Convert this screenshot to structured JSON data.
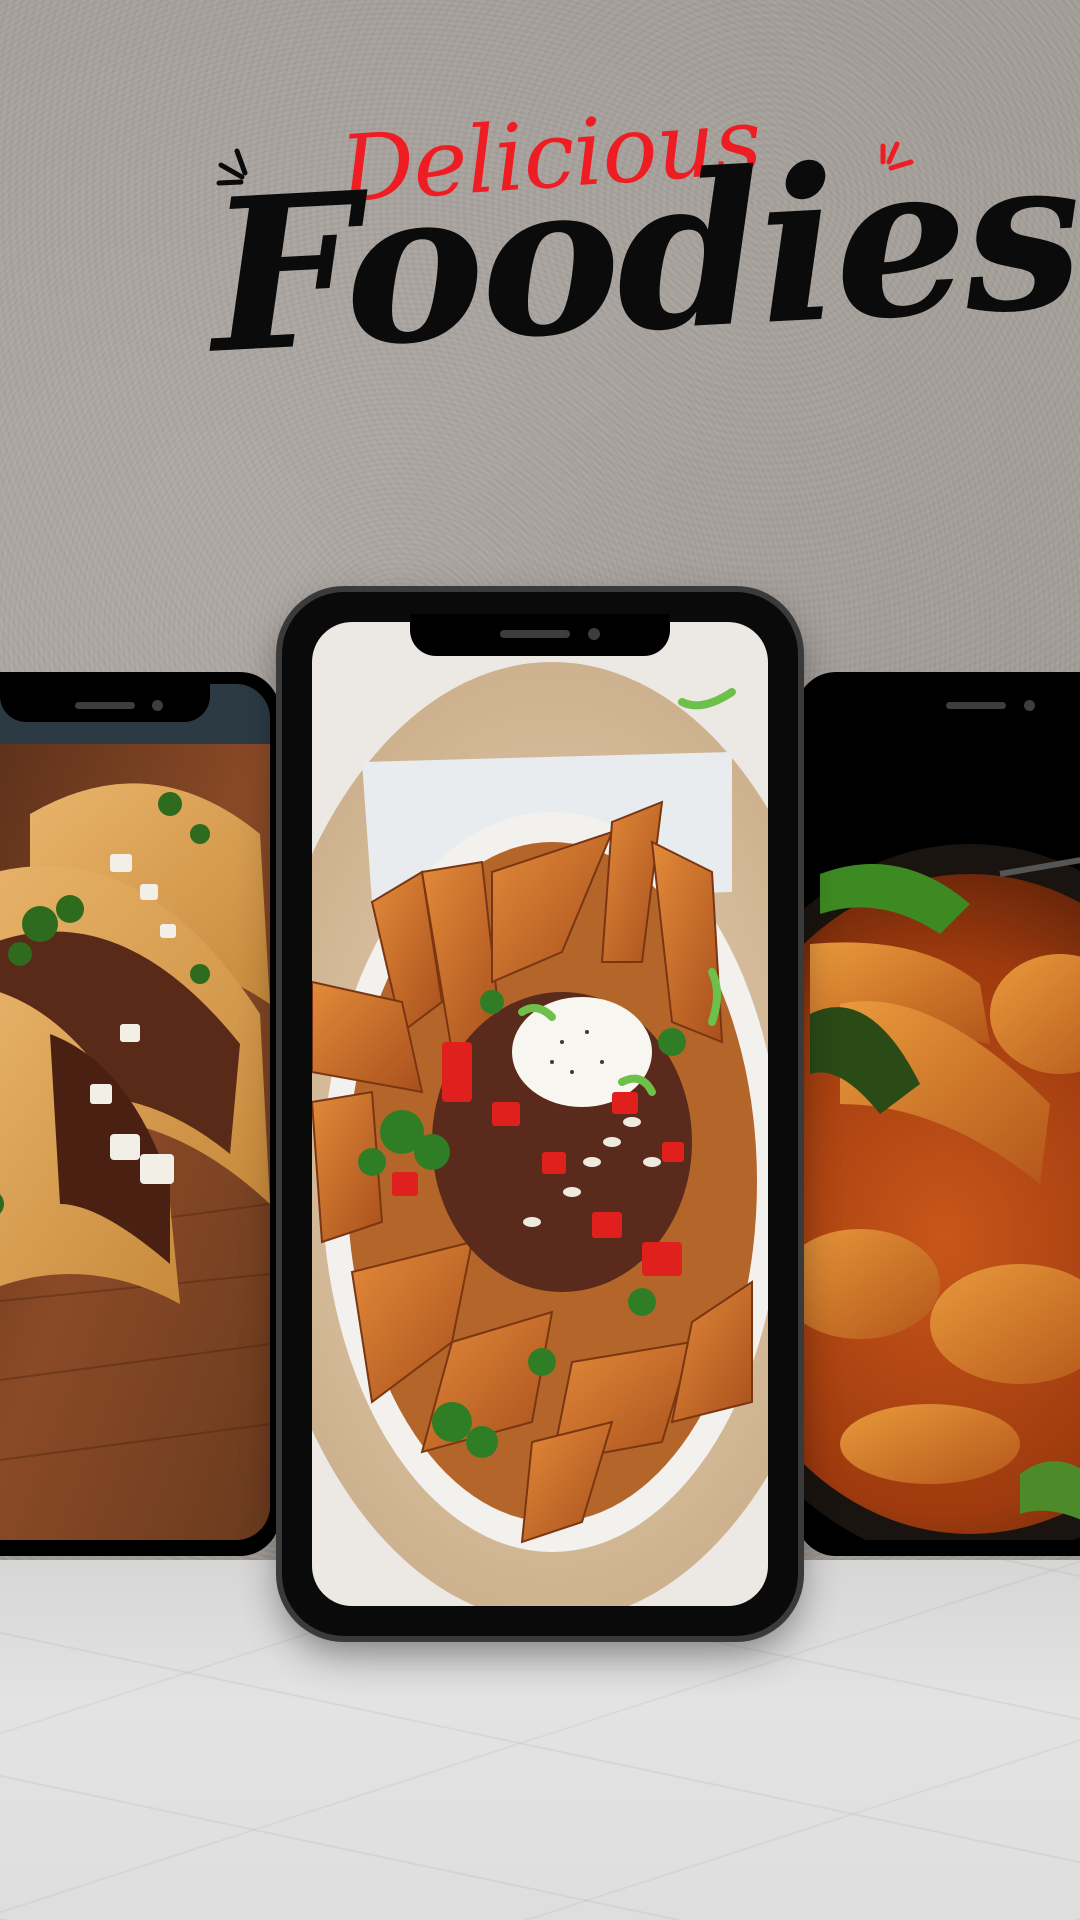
{
  "title": {
    "script": "Delicious",
    "main": "Foodies"
  },
  "colors": {
    "accent_red": "#ee1d24",
    "title_black": "#0b0b0b",
    "wall": "#a39d98",
    "floor": "#dedede"
  },
  "phones": [
    {
      "position": "left",
      "photo": "beef tacos on wooden board"
    },
    {
      "position": "center",
      "photo": "sweet potato fries bowl with salsa and sour cream"
    },
    {
      "position": "right",
      "photo": "chicken curry with peppers"
    }
  ]
}
